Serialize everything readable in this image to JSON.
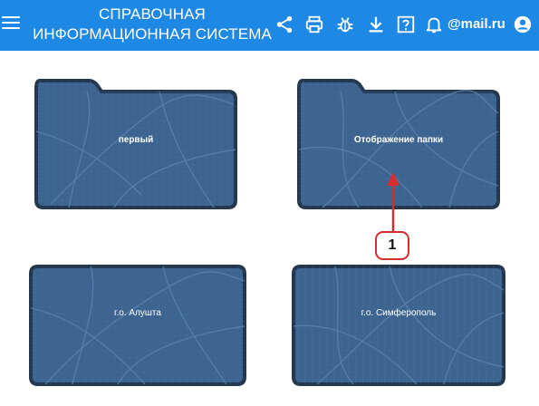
{
  "header": {
    "title_line1": "СПРАВОЧНАЯ",
    "title_line2": "ИНФОРМАЦИОННАЯ СИСТЕМА",
    "user": "@mail.ru",
    "icons": [
      "menu-icon",
      "share-icon",
      "print-icon",
      "bug-icon",
      "download-icon",
      "help-icon",
      "bell-icon",
      "account-icon"
    ]
  },
  "folders": [
    {
      "label": "первый"
    },
    {
      "label": "Отображение папки"
    },
    {
      "label": "г.о. Алушта"
    },
    {
      "label": "г.о. Симферополь"
    }
  ],
  "annotation": {
    "number": "1",
    "color": "#d32f2f"
  },
  "colors": {
    "header": "#1e88e5",
    "folder_fill": "#3d6490",
    "folder_border": "#23384f"
  }
}
